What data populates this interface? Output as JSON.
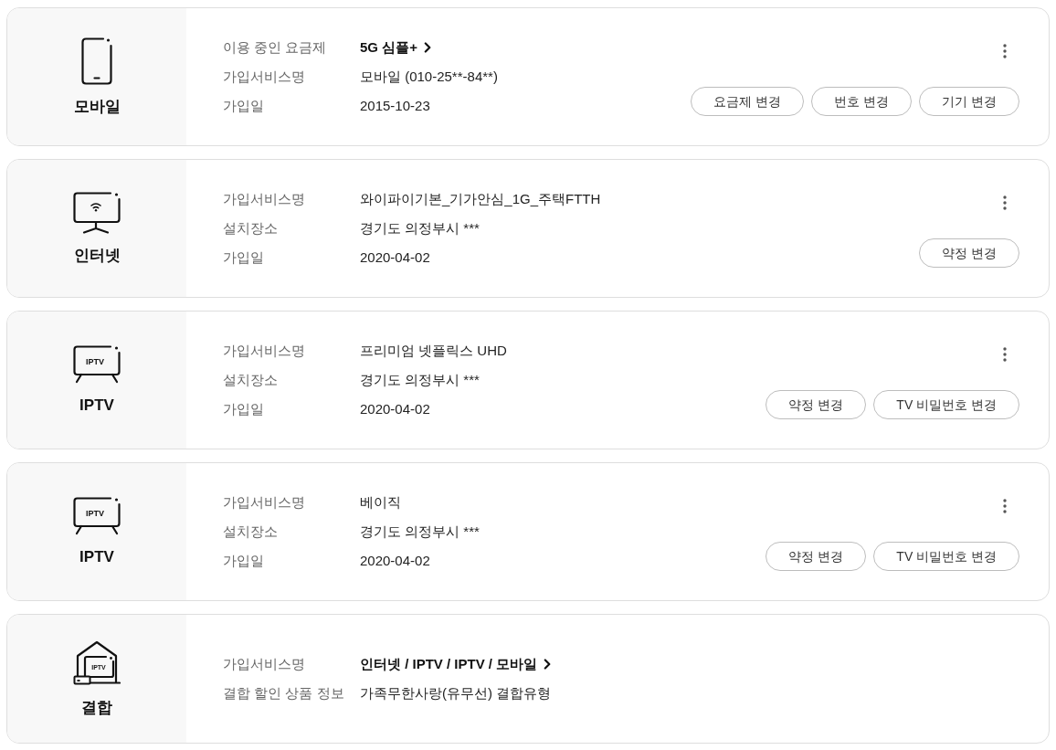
{
  "services": [
    {
      "kind": "mobile",
      "category": "모바일",
      "menu": true,
      "details": [
        {
          "label": "이용 중인 요금제",
          "value": "5G 심플+",
          "link": true
        },
        {
          "label": "가입서비스명",
          "value": "모바일 (010-25**-84**)",
          "link": false
        },
        {
          "label": "가입일",
          "value": "2015-10-23",
          "link": false
        }
      ],
      "buttons": [
        "요금제 변경",
        "번호 변경",
        "기기 변경"
      ]
    },
    {
      "kind": "internet",
      "category": "인터넷",
      "menu": true,
      "details": [
        {
          "label": "가입서비스명",
          "value": "와이파이기본_기가안심_1G_주택FTTH",
          "link": false
        },
        {
          "label": "설치장소",
          "value": "경기도 의정부시 ***",
          "link": false
        },
        {
          "label": "가입일",
          "value": "2020-04-02",
          "link": false
        }
      ],
      "buttons": [
        "약정 변경"
      ]
    },
    {
      "kind": "iptv",
      "icon_text": "IPTV",
      "category": "IPTV",
      "menu": true,
      "details": [
        {
          "label": "가입서비스명",
          "value": "프리미엄 넷플릭스 UHD",
          "link": false
        },
        {
          "label": "설치장소",
          "value": "경기도 의정부시 ***",
          "link": false
        },
        {
          "label": "가입일",
          "value": "2020-04-02",
          "link": false
        }
      ],
      "buttons": [
        "약정 변경",
        "TV 비밀번호 변경"
      ]
    },
    {
      "kind": "iptv",
      "icon_text": "IPTV",
      "category": "IPTV",
      "menu": true,
      "details": [
        {
          "label": "가입서비스명",
          "value": "베이직",
          "link": false
        },
        {
          "label": "설치장소",
          "value": "경기도 의정부시 ***",
          "link": false
        },
        {
          "label": "가입일",
          "value": "2020-04-02",
          "link": false
        }
      ],
      "buttons": [
        "약정 변경",
        "TV 비밀번호 변경"
      ]
    },
    {
      "kind": "bundle",
      "icon_text": "IPTV",
      "category": "결합",
      "menu": false,
      "details": [
        {
          "label": "가입서비스명",
          "value": "인터넷 / IPTV / IPTV / 모바일",
          "link": true
        },
        {
          "label": "결합 할인 상품 정보",
          "value": "가족무한사랑(유무선) 결합유형",
          "link": false
        }
      ]
    }
  ]
}
